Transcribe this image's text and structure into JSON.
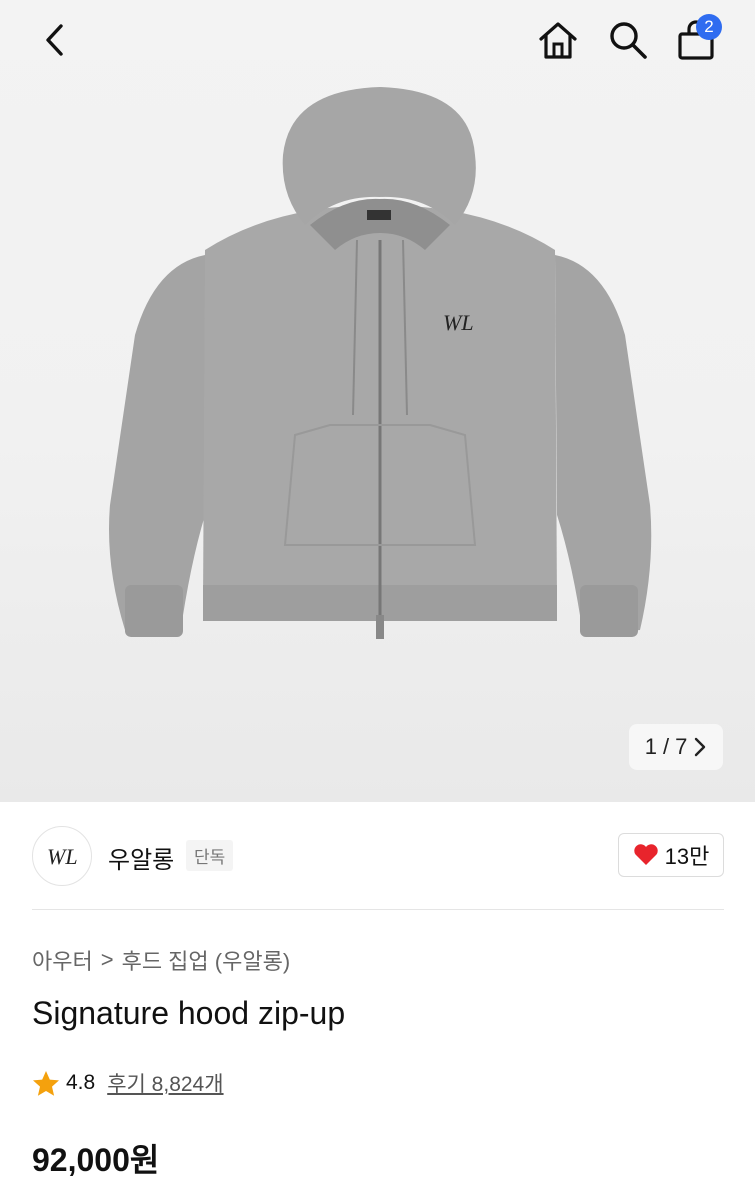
{
  "header": {
    "back_icon": "chevron-left-icon",
    "home_icon": "home-icon",
    "search_icon": "search-icon",
    "cart_icon": "shopping-bag-icon",
    "cart_count": "2"
  },
  "gallery": {
    "current": "1",
    "separator": "/",
    "total": "7",
    "next_icon": "chevron-right-icon"
  },
  "brand": {
    "name": "우알롱",
    "tag": "단독",
    "logo_text": "WL",
    "likes": "13만"
  },
  "breadcrumb": {
    "category": "아우터",
    "separator": ">",
    "subcategory": "후드 집업 (우알롱)"
  },
  "product": {
    "title": "Signature hood zip-up",
    "rating": "4.8",
    "reviews": "후기 8,824개",
    "price": "92,000원"
  },
  "colors": {
    "badge": "#2f6cf0",
    "heart": "#e8242c",
    "star": "#f4a10d"
  }
}
